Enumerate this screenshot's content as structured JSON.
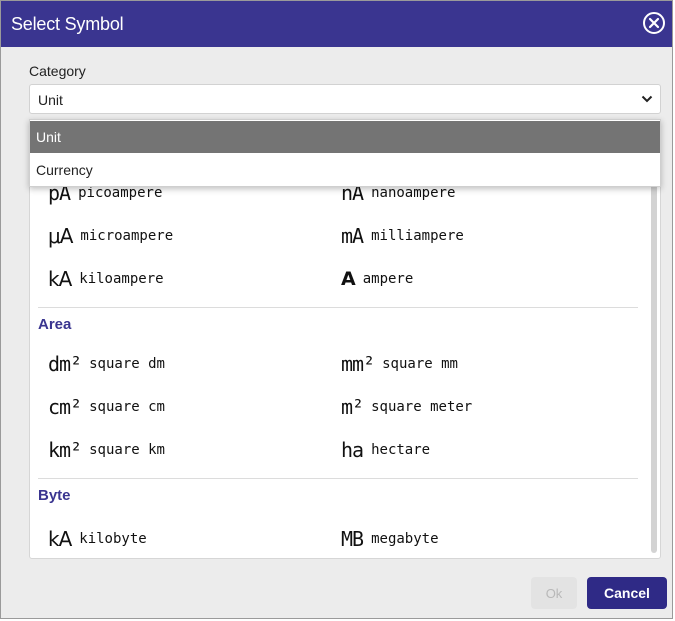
{
  "dialog": {
    "title": "Select Symbol",
    "close_icon": "close-circle-icon",
    "accent_color": "#3a3590"
  },
  "category": {
    "label": "Category",
    "selected": "Unit",
    "options": [
      "Unit",
      "Currency"
    ]
  },
  "sections": [
    {
      "heading": "",
      "items": [
        {
          "symbol": "pA",
          "name": "picoampere"
        },
        {
          "symbol": "nA",
          "name": "nanoampere"
        },
        {
          "symbol": "μA",
          "name": "microampere"
        },
        {
          "symbol": "mA",
          "name": "milliampere"
        },
        {
          "symbol": "kA",
          "name": "kiloampere"
        },
        {
          "symbol": "A",
          "name": "ampere"
        }
      ]
    },
    {
      "heading": "Area",
      "items": [
        {
          "symbol": "dm²",
          "name": "square dm"
        },
        {
          "symbol": "mm²",
          "name": "square mm"
        },
        {
          "symbol": "cm²",
          "name": "square cm"
        },
        {
          "symbol": "m²",
          "name": "square meter"
        },
        {
          "symbol": "km²",
          "name": "square km"
        },
        {
          "symbol": "ha",
          "name": "hectare"
        }
      ]
    },
    {
      "heading": "Byte",
      "items": [
        {
          "symbol": "kA",
          "name": "kilobyte"
        },
        {
          "symbol": "MB",
          "name": "megabyte"
        }
      ]
    }
  ],
  "footer": {
    "ok_label": "Ok",
    "cancel_label": "Cancel"
  }
}
